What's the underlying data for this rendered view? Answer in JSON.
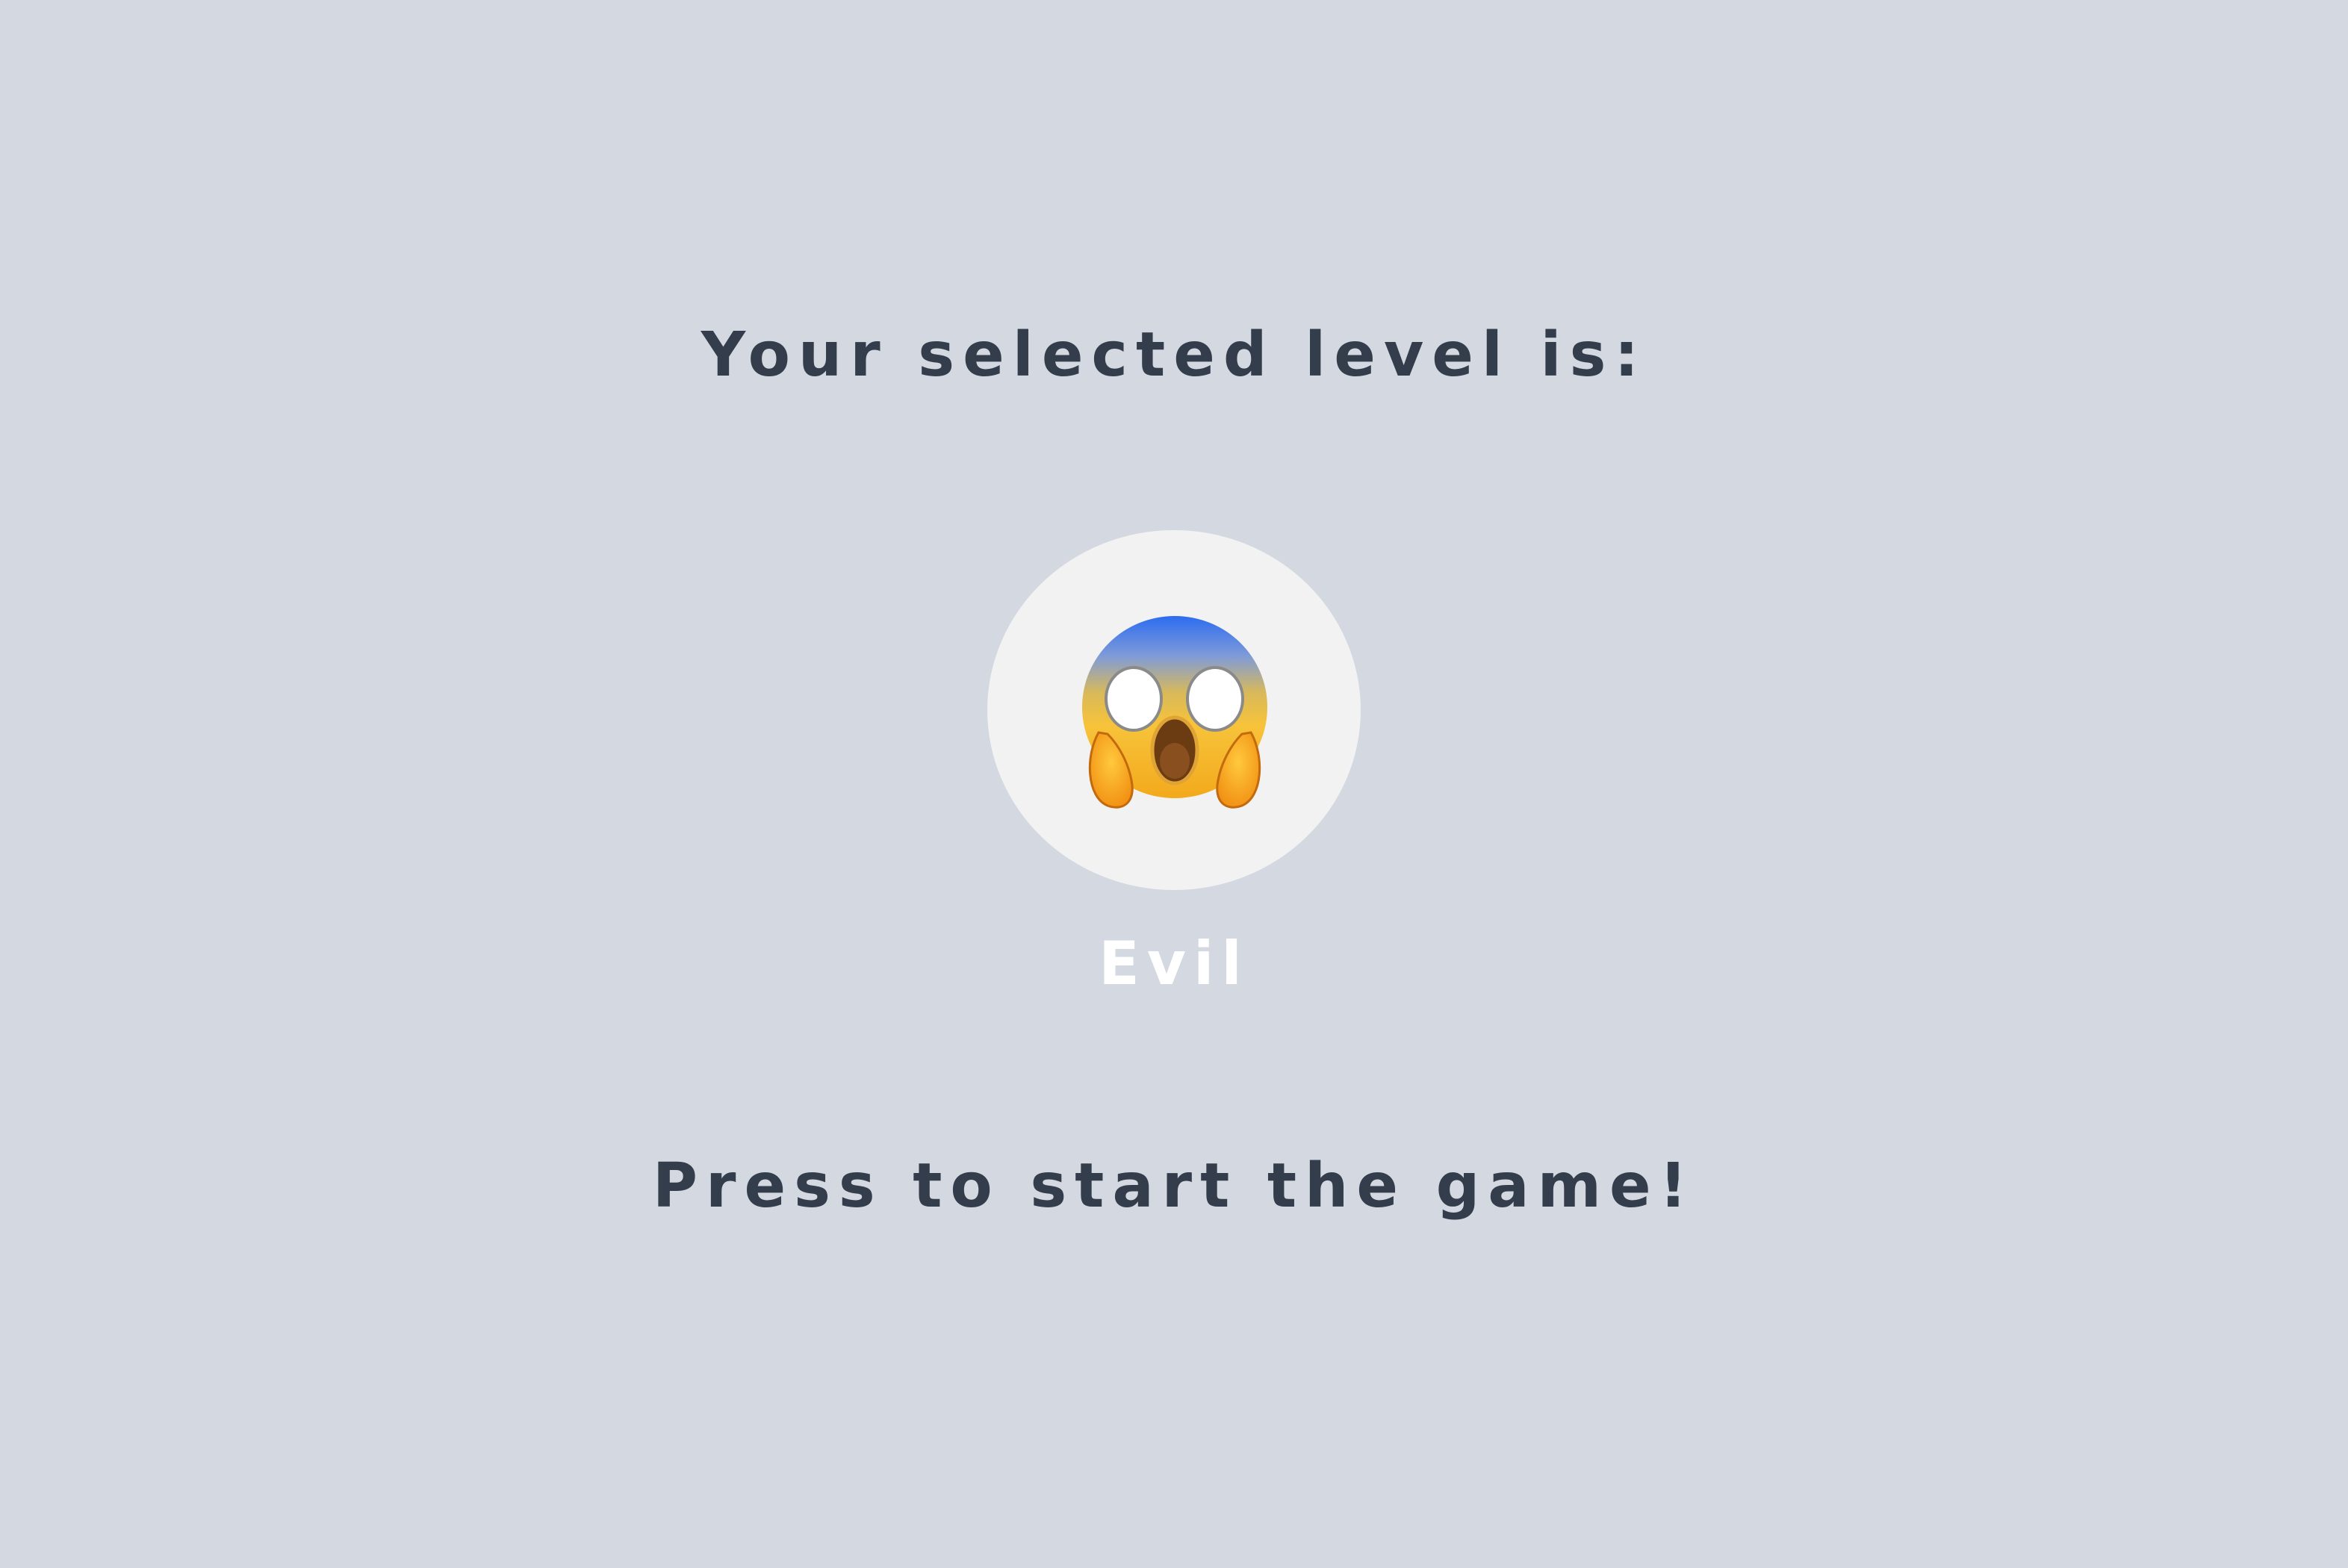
{
  "screen": {
    "heading": "Your selected level is:",
    "start_prompt": "Press to start the game!"
  },
  "level": {
    "name": "Evil",
    "icon": "face-screaming-in-fear-icon"
  },
  "colors": {
    "background": "#d4d8e0",
    "text_dark": "#343d4c",
    "text_light": "#ffffff",
    "badge": "#f2f2f2"
  }
}
